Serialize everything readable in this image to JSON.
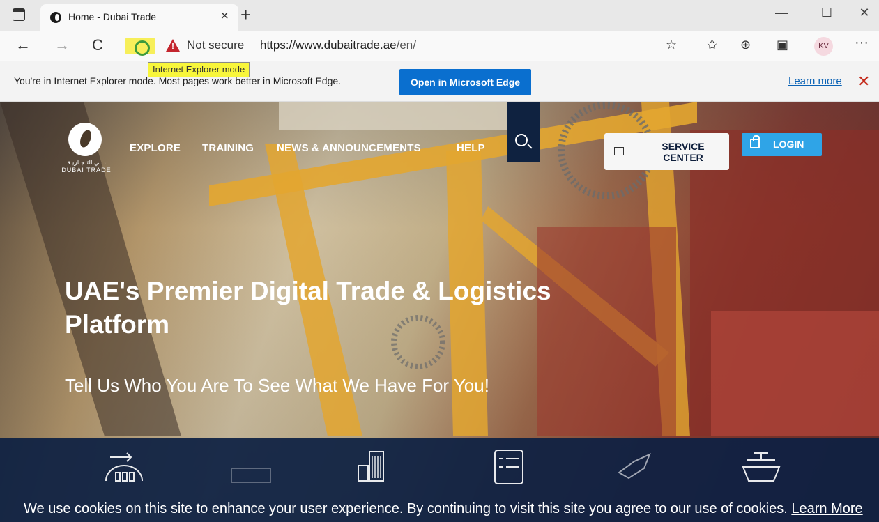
{
  "browser": {
    "tab_title": "Home - Dubai Trade",
    "tab_close": "×",
    "new_tab": "+",
    "window_controls": {
      "minimize": "—",
      "maximize": "☐",
      "close": "✕"
    },
    "nav": {
      "back": "←",
      "forward": "→",
      "refresh": "C"
    },
    "security_label": "Not secure",
    "url_host": "https://www.dubaitrade.ae",
    "url_path": "/en/",
    "ie_tooltip": "Internet Explorer mode",
    "toolbar_icons": [
      "favorites-add-icon",
      "favorites-icon",
      "collections-icon",
      "ie-mode-icon"
    ],
    "profile_initials": "KV",
    "more_menu": "···"
  },
  "infobar": {
    "message": "You're in Internet Explorer mode. Most pages work better in Microsoft Edge.",
    "open_button": "Open in Microsoft Edge",
    "learn_more": "Learn more",
    "close": "✕"
  },
  "site": {
    "logo_arabic": "دبـي التـجـاريـة",
    "logo_text": "DUBAI TRADE",
    "nav": {
      "explore": "EXPLORE",
      "training": "TRAINING",
      "news": "NEWS & ANNOUNCEMENTS",
      "help": "HELP"
    },
    "service_center": "SERVICE CENTER",
    "login": "LOGIN",
    "hero_title": "UAE's Premier Digital Trade & Logistics Platform",
    "hero_subtitle": "Tell Us Who You Are To See What We Have For You!",
    "category_icons": [
      "trader-icon",
      "transport-icon",
      "building-icon",
      "document-list-icon",
      "shipping-agent-icon",
      "vessel-icon"
    ],
    "cookie_message": "We use cookies on this site to enhance your user experience. By continuing to visit this site you agree to our use of cookies.",
    "cookie_learn_more": "Learn More"
  },
  "colors": {
    "edge_blue": "#0a6fcf",
    "login_blue": "#2fa4e7",
    "navy": "#0d2043",
    "warning_red": "#c4262e",
    "tooltip_yellow": "#f8f63b"
  }
}
